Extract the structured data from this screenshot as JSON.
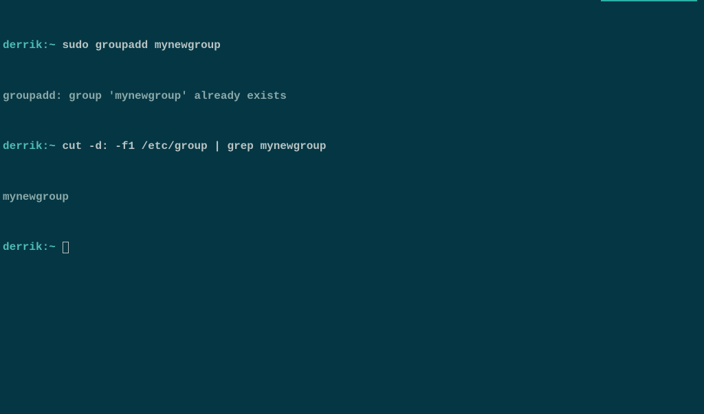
{
  "colors": {
    "background": "#053643",
    "prompt": "#4fbcb4",
    "command": "#b8c4c4",
    "output": "#8aa9a9"
  },
  "prompt": {
    "user": "derrik",
    "sep": ":",
    "path": "~",
    "suffix": " "
  },
  "lines": [
    {
      "type": "command",
      "command": "sudo groupadd mynewgroup"
    },
    {
      "type": "output",
      "text": "groupadd: group 'mynewgroup' already exists"
    },
    {
      "type": "command",
      "command": "cut -d: -f1 /etc/group | grep mynewgroup"
    },
    {
      "type": "output",
      "text": "mynewgroup"
    },
    {
      "type": "prompt_only"
    }
  ]
}
